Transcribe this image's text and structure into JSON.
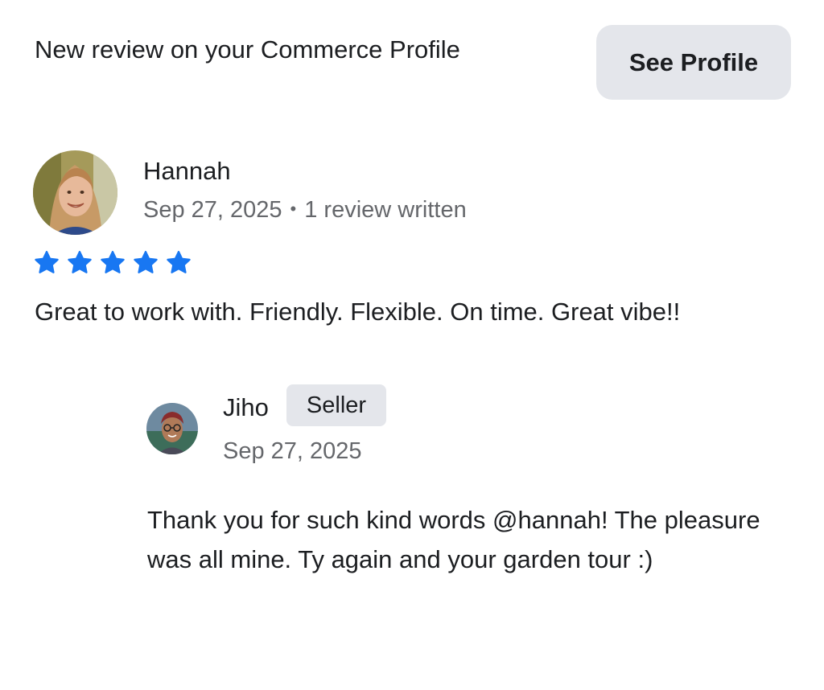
{
  "header": {
    "title": "New review on your Commerce Profile",
    "see_profile_label": "See Profile"
  },
  "review": {
    "reviewer_name": "Hannah",
    "date": "Sep 27, 2025",
    "separator": "•",
    "reviews_written": "1 review written",
    "rating": 5,
    "rating_max": 5,
    "star_color": "#1877f2",
    "text": "Great to work with. Friendly. Flexible. On time. Great vibe!!",
    "avatar_icon": "reviewer-avatar-photo"
  },
  "reply": {
    "seller_name": "Jiho",
    "badge": "Seller",
    "date": "Sep 27, 2025",
    "text": "Thank you for such kind words @hannah! The pleasure was all mine. Ty again and your garden tour :)",
    "avatar_icon": "seller-avatar-photo"
  }
}
